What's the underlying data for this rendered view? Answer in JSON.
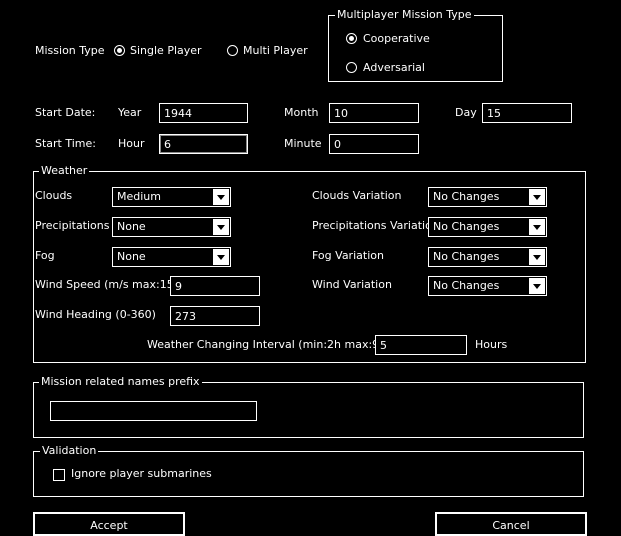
{
  "mission": {
    "type_label": "Mission Type",
    "single_player": "Single Player",
    "multi_player": "Multi Player",
    "selected": "single_player"
  },
  "multiplayer": {
    "legend": "Multiplayer Mission Type",
    "cooperative": "Cooperative",
    "adversarial": "Adversarial",
    "selected": "cooperative"
  },
  "start_date": {
    "label": "Start Date:",
    "year_label": "Year",
    "year": "1944",
    "month_label": "Month",
    "month": "10",
    "day_label": "Day",
    "day": "15"
  },
  "start_time": {
    "label": "Start Time:",
    "hour_label": "Hour",
    "hour": "6",
    "minute_label": "Minute",
    "minute": "0"
  },
  "weather": {
    "legend": "Weather",
    "clouds_label": "Clouds",
    "clouds": "Medium",
    "precip_label": "Precipitations",
    "precip": "None",
    "fog_label": "Fog",
    "fog": "None",
    "wind_speed_label": "Wind Speed (m/s max:15)",
    "wind_speed": "9",
    "wind_heading_label": "Wind Heading (0-360)",
    "wind_heading": "273",
    "clouds_var_label": "Clouds Variation",
    "clouds_var": "No Changes",
    "precip_var_label": "Precipitations Variation",
    "precip_var": "No Changes",
    "fog_var_label": "Fog Variation",
    "fog_var": "No Changes",
    "wind_var_label": "Wind Variation",
    "wind_var": "No Changes",
    "interval_label": "Weather Changing Interval (min:2h  max:96h)",
    "interval": "5",
    "interval_unit": "Hours"
  },
  "prefix": {
    "legend": "Mission related names prefix",
    "value": ""
  },
  "validation": {
    "legend": "Validation",
    "ignore_subs_label": "Ignore player submarines",
    "ignore_subs": false
  },
  "buttons": {
    "accept": "Accept",
    "cancel": "Cancel"
  }
}
